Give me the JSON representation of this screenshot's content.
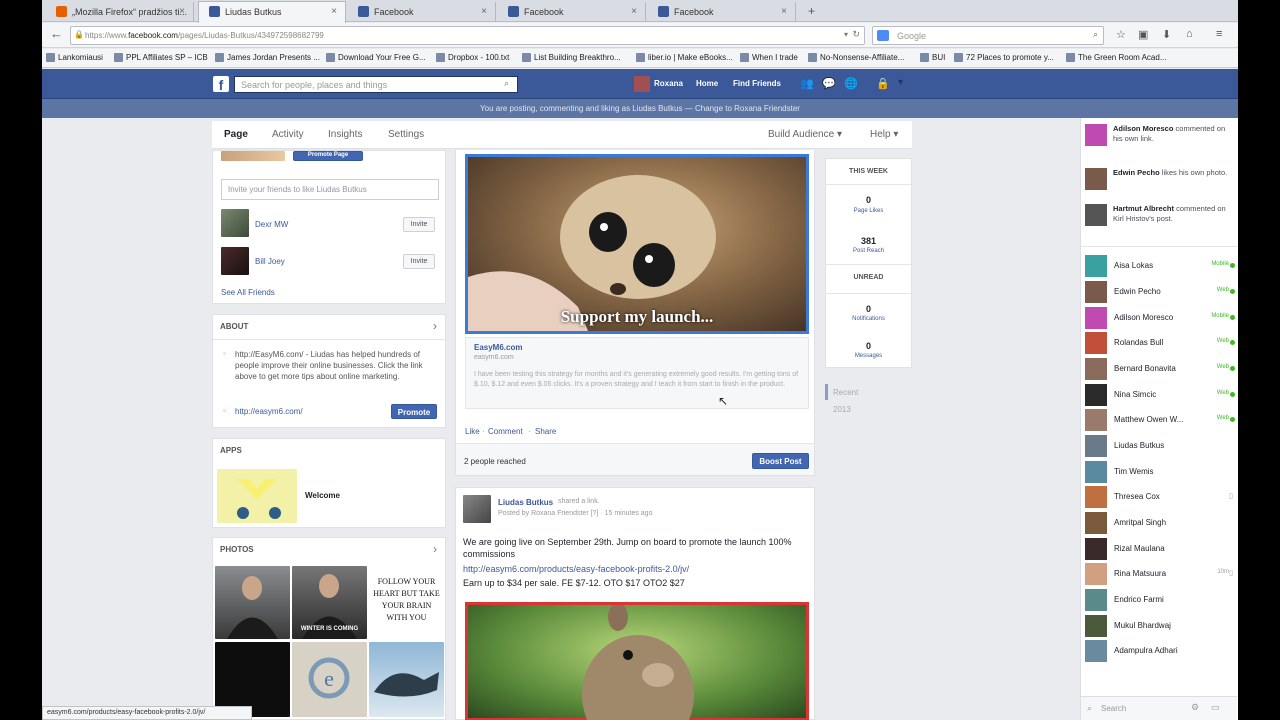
{
  "browser": {
    "tabs": [
      {
        "label": "„Mozilla Firefox“ pradžios ti..."
      },
      {
        "label": "Liudas Butkus"
      },
      {
        "label": "Facebook"
      },
      {
        "label": "Facebook"
      },
      {
        "label": "Facebook"
      }
    ],
    "new_tab": "+",
    "url_prefix": "https://www.",
    "url_host": "facebook.com",
    "url_path": "/pages/Liudas-Butkus/434972598682799",
    "search_placeholder": "Google",
    "bookmarks": [
      "Lankomiausi",
      "PPL Affiliates SP – ICB",
      "James Jordan Presents ...",
      "Download Your Free G...",
      "Dropbox - 100.txt",
      "List Building Breakthro...",
      "liber.io | Make eBooks...",
      "When I trade",
      "No-Nonsense-Affiliate...",
      "BUI",
      "72 Places to promote y...",
      "The Green Room Acad..."
    ],
    "status_url": "easym6.com/products/easy-facebook-profits-2.0/jv/"
  },
  "fb": {
    "logo": "f",
    "search_placeholder": "Search for people, places and things",
    "user_name": "Roxana",
    "home": "Home",
    "find_friends": "Find Friends",
    "posting_notice": "You are posting, commenting and liking as Liudas Butkus — Change to Roxana Friendster"
  },
  "page_tabs": {
    "page": "Page",
    "activity": "Activity",
    "insights": "Insights",
    "settings": "Settings",
    "build_audience": "Build Audience ▾",
    "help": "Help ▾"
  },
  "left": {
    "promote_page": "Promote Page",
    "invite_placeholder": "Invite your friends to like Liudas Butkus",
    "friends": [
      {
        "name": "Dexr MW",
        "action": "Invite"
      },
      {
        "name": "Bill Joey",
        "action": "Invite"
      }
    ],
    "see_all": "See All Friends",
    "about_title": "ABOUT",
    "about_text": "http://EasyM6.com/ - Liudas has helped hundreds of people improve their online businesses. Click the link above to get more tips about online marketing.",
    "about_link": "http://easym6.com/",
    "promote": "Promote",
    "apps_title": "APPS",
    "app_name": "Welcome",
    "photos_title": "PHOTOS",
    "photo_quote": "FOLLOW YOUR HEART BUT TAKE YOUR BRAIN WITH YOU",
    "photo_caption": "WINTER IS COMING"
  },
  "post1": {
    "image_caption": "Support my launch...",
    "link_title": "EasyM6.com",
    "link_domain": "easym6.com",
    "link_desc": "I have been testing this strategy for months and it's generating extremely good results. I'm getting tons of $.10, $.12 and even $.05 clicks. It's a proven strategy and I teach it from start to finish in the product.",
    "like": "Like",
    "comment": "Comment",
    "share": "Share",
    "reached": "2 people reached",
    "boost": "Boost Post"
  },
  "post2": {
    "author": "Liudas Butkus",
    "shared": "shared a link.",
    "posted_by": "Posted by Roxana Friendster [?] · 15 minutes ago",
    "text": "We are going live on September 29th. Jump on board to promote the launch 100% commissions",
    "link": "http://easym6.com/products/easy-facebook-profits-2.0/jv/",
    "earn": "Earn up to $34 per sale. FE $7-12. OTO $17 OTO2 $27"
  },
  "stats": {
    "this_week": "THIS WEEK",
    "page_likes_val": "0",
    "page_likes": "Page Likes",
    "post_reach_val": "381",
    "post_reach": "Post Reach",
    "unread": "UNREAD",
    "notif_val": "0",
    "notifications": "Notifications",
    "messages_val": "0",
    "messages": "Messages",
    "recent": "Recent",
    "year": "2013"
  },
  "ticker": [
    {
      "name": "Adilson Moresco",
      "text": "commented on his own link."
    },
    {
      "name": "Edwin Pecho",
      "text": "likes his own photo."
    },
    {
      "name": "Hartmut Albrecht",
      "text": "commented on Kirl Hristov's post."
    }
  ],
  "chat": [
    {
      "name": "Aisa Lokas",
      "status": "Mobile"
    },
    {
      "name": "Edwin Pecho",
      "status": "Web"
    },
    {
      "name": "Adilson Moresco",
      "status": "Mobile"
    },
    {
      "name": "Rolandas Bull",
      "status": "Web"
    },
    {
      "name": "Bernard Bonavita",
      "status": "Web"
    },
    {
      "name": "Nina Simcic",
      "status": "Web"
    },
    {
      "name": "Matthew Owen W...",
      "status": "Web"
    },
    {
      "name": "Liudas Butkus",
      "status": ""
    },
    {
      "name": "Tim Wemis",
      "status": ""
    },
    {
      "name": "Thresea Cox",
      "status": ""
    },
    {
      "name": "Amritpal Singh",
      "status": ""
    },
    {
      "name": "Rizal Maulana",
      "status": ""
    },
    {
      "name": "Rina Matsuura",
      "status": "10m"
    },
    {
      "name": "Endrico Farmi",
      "status": ""
    },
    {
      "name": "Mukul Bhardwaj",
      "status": ""
    },
    {
      "name": "Adampulra Adhari",
      "status": ""
    }
  ],
  "chat_search": "Search",
  "colors": {
    "fb_blue": "#3b5998",
    "online": "#42b72a"
  }
}
